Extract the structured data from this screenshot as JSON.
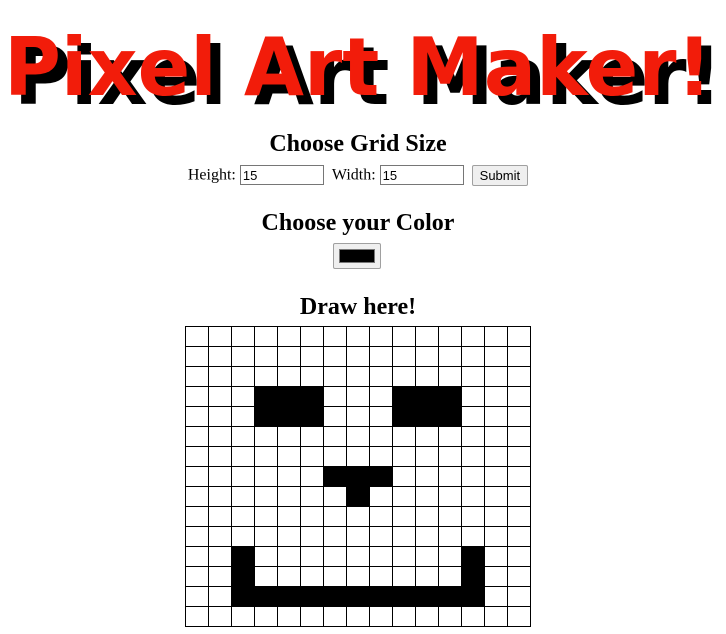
{
  "app": {
    "title": "Pixel Art Maker!",
    "title_color": "#f21c0a",
    "shadow_color": "#000000"
  },
  "grid_size": {
    "heading": "Choose Grid Size",
    "height_label": "Height:",
    "height_value": "15",
    "width_label": "Width:",
    "width_value": "15",
    "submit_label": "Submit"
  },
  "color": {
    "heading": "Choose your Color",
    "value": "#000000"
  },
  "canvas": {
    "heading": "Draw here!",
    "rows": 15,
    "cols": 15,
    "filled_color": "#000000",
    "filled_cells": [
      [
        3,
        3
      ],
      [
        3,
        4
      ],
      [
        3,
        5
      ],
      [
        3,
        9
      ],
      [
        3,
        10
      ],
      [
        3,
        11
      ],
      [
        4,
        3
      ],
      [
        4,
        4
      ],
      [
        4,
        5
      ],
      [
        4,
        9
      ],
      [
        4,
        10
      ],
      [
        4,
        11
      ],
      [
        7,
        6
      ],
      [
        7,
        7
      ],
      [
        7,
        8
      ],
      [
        8,
        7
      ],
      [
        11,
        2
      ],
      [
        11,
        12
      ],
      [
        12,
        2
      ],
      [
        12,
        12
      ],
      [
        13,
        2
      ],
      [
        13,
        3
      ],
      [
        13,
        4
      ],
      [
        13,
        5
      ],
      [
        13,
        6
      ],
      [
        13,
        7
      ],
      [
        13,
        8
      ],
      [
        13,
        9
      ],
      [
        13,
        10
      ],
      [
        13,
        11
      ],
      [
        13,
        12
      ]
    ]
  }
}
